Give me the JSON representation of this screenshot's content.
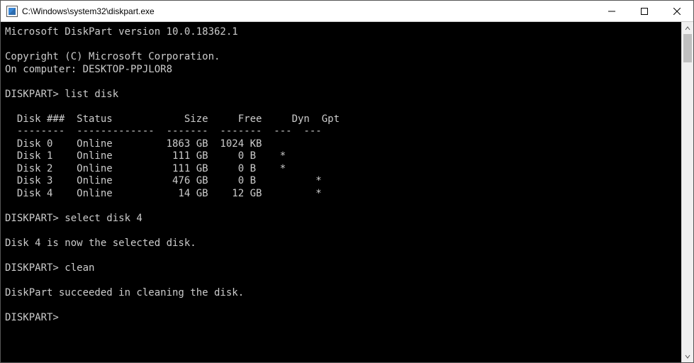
{
  "window": {
    "title": "C:\\Windows\\system32\\diskpart.exe"
  },
  "terminal": {
    "version_line": "Microsoft DiskPart version 10.0.18362.1",
    "copyright_line": "Copyright (C) Microsoft Corporation.",
    "computer_line": "On computer: DESKTOP-PPJLOR8",
    "prompt": "DISKPART>",
    "cmd1": "list disk",
    "table_header1": "Disk ###",
    "table_header2": "Status",
    "table_header3": "Size",
    "table_header4": "Free",
    "table_header5": "Dyn",
    "table_header6": "Gpt",
    "dash1": "--------",
    "dash2": "-------------",
    "dash3": "-------",
    "dash4": "-------",
    "dash5": "---",
    "dash6": "---",
    "rows": [
      {
        "disk": "Disk 0",
        "status": "Online",
        "size": "1863 GB",
        "free": "1024 KB",
        "dyn": "",
        "gpt": ""
      },
      {
        "disk": "Disk 1",
        "status": "Online",
        "size": " 111 GB",
        "free": "   0 B ",
        "dyn": "*",
        "gpt": ""
      },
      {
        "disk": "Disk 2",
        "status": "Online",
        "size": " 111 GB",
        "free": "   0 B ",
        "dyn": "*",
        "gpt": ""
      },
      {
        "disk": "Disk 3",
        "status": "Online",
        "size": " 476 GB",
        "free": "   0 B ",
        "dyn": "",
        "gpt": "*"
      },
      {
        "disk": "Disk 4",
        "status": "Online",
        "size": "  14 GB",
        "free": "  12 GB",
        "dyn": "",
        "gpt": "*"
      }
    ],
    "cmd2": "select disk 4",
    "resp2": "Disk 4 is now the selected disk.",
    "cmd3": "clean",
    "resp3": "DiskPart succeeded in cleaning the disk."
  }
}
